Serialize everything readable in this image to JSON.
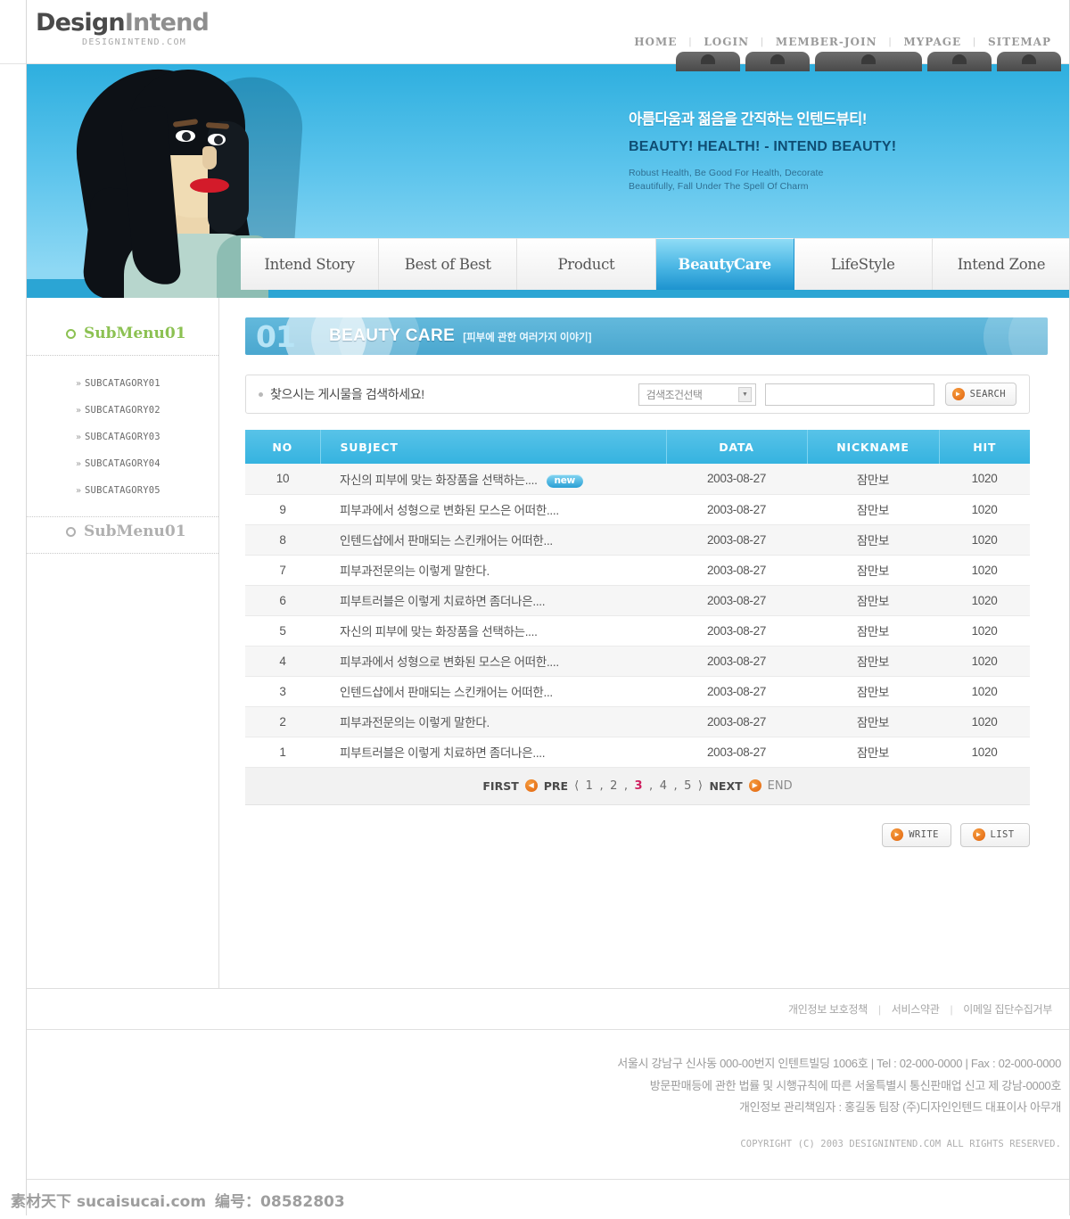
{
  "brand": {
    "logo_part1": "Design",
    "logo_part2": "Intend",
    "logo_domain": "DESIGNINTEND.COM"
  },
  "topnav": {
    "items": [
      "HOME",
      "LOGIN",
      "MEMBER-JOIN",
      "MYPAGE",
      "SITEMAP"
    ],
    "separator": "|"
  },
  "hero": {
    "korean_headline": "아름다움과 젊음을 간직하는 인텐드뷰티!",
    "english_headline": "BEAUTY! HEALTH! - INTEND BEAUTY!",
    "sub_line1": "Robust Health, Be Good For  Health, Decorate",
    "sub_line2": "Beautifully, Fall Under The Spell Of  Charm"
  },
  "mainnav": {
    "tabs": [
      {
        "label": "Intend Story",
        "active": false
      },
      {
        "label": "Best of Best",
        "active": false
      },
      {
        "label": "Product",
        "active": false
      },
      {
        "label": "BeautyCare",
        "active": true
      },
      {
        "label": "LifeStyle",
        "active": false
      },
      {
        "label": "Intend Zone",
        "active": false
      }
    ]
  },
  "sidebar": {
    "menu1_title": "SubMenu01",
    "menu2_title": "SubMenu01",
    "chevron": "»",
    "subcategories": [
      "SUBCATAGORY01",
      "SUBCATAGORY02",
      "SUBCATAGORY03",
      "SUBCATAGORY04",
      "SUBCATAGORY05"
    ]
  },
  "banner": {
    "number": "01",
    "title": "BEAUTY CARE",
    "subtitle": "[피부에 관한 여러가지 이야기]"
  },
  "search": {
    "label": "찾으시는 게시물을 검색하세요!",
    "select_value": "검색조건선택",
    "input_value": "",
    "input_placeholder": "",
    "button_label": "SEARCH",
    "caret": "▼",
    "arrow": "▶"
  },
  "table": {
    "headers": [
      "NO",
      "SUBJECT",
      "DATA",
      "NICKNAME",
      "HIT"
    ],
    "new_badge": "new",
    "rows": [
      {
        "no": "10",
        "subject": "자신의 피부에 맞는 화장품을 선택하는....",
        "date": "2003-08-27",
        "nickname": "잠만보",
        "hit": "1020",
        "is_new": true
      },
      {
        "no": "9",
        "subject": "피부과에서 성형으로 변화된 모스은 어떠한....",
        "date": "2003-08-27",
        "nickname": "잠만보",
        "hit": "1020",
        "is_new": false
      },
      {
        "no": "8",
        "subject": "인텐드샵에서 판매되는 스킨캐어는 어떠한...",
        "date": "2003-08-27",
        "nickname": "잠만보",
        "hit": "1020",
        "is_new": false
      },
      {
        "no": "7",
        "subject": "피부과전문의는 이렇게 말한다.",
        "date": "2003-08-27",
        "nickname": "잠만보",
        "hit": "1020",
        "is_new": false
      },
      {
        "no": "6",
        "subject": "피부트러블은 이렇게 치료하면 좀더나은....",
        "date": "2003-08-27",
        "nickname": "잠만보",
        "hit": "1020",
        "is_new": false
      },
      {
        "no": "5",
        "subject": "자신의 피부에 맞는 화장품을 선택하는....",
        "date": "2003-08-27",
        "nickname": "잠만보",
        "hit": "1020",
        "is_new": false
      },
      {
        "no": "4",
        "subject": "피부과에서 성형으로 변화된 모스은 어떠한....",
        "date": "2003-08-27",
        "nickname": "잠만보",
        "hit": "1020",
        "is_new": false
      },
      {
        "no": "3",
        "subject": "인텐드샵에서 판매되는 스킨캐어는 어떠한...",
        "date": "2003-08-27",
        "nickname": "잠만보",
        "hit": "1020",
        "is_new": false
      },
      {
        "no": "2",
        "subject": "피부과전문의는 이렇게 말한다.",
        "date": "2003-08-27",
        "nickname": "잠만보",
        "hit": "1020",
        "is_new": false
      },
      {
        "no": "1",
        "subject": "피부트러블은 이렇게 치료하면 좀더나은....",
        "date": "2003-08-27",
        "nickname": "잠만보",
        "hit": "1020",
        "is_new": false
      }
    ]
  },
  "pager": {
    "first": "FIRST",
    "pre": "PRE",
    "open": "⟨",
    "close": "⟩",
    "pages": [
      "1",
      "2",
      "3",
      "4",
      "5"
    ],
    "current_page": "3",
    "next": "NEXT",
    "end": "END",
    "left_arrow": "◀",
    "right_arrow": "▶"
  },
  "actions": {
    "write_label": "WRITE",
    "list_label": "LIST",
    "arrow": "▶"
  },
  "footer": {
    "links": [
      "개인정보 보호정책",
      "서비스약관",
      "이메일 집단수집거부"
    ],
    "separator": "|",
    "address_line1": "서울시  강남구 신사동 000-00번지  인텐트빌딩 1006호   | Tel : 02-000-0000 | Fax : 02-000-0000",
    "address_line2": "방문판매등에 관한 법률 및 시행규칙에 따른 서울특별시 통신판매업 신고 제 강남-0000호",
    "address_line3": "개인정보 관리책임자 : 홍길동 팀장 (주)디자인인텐드 대표이사 아무개",
    "copyright": "COPYRIGHT (C) 2003 DESIGNINTEND.COM ALL RIGHTS RESERVED."
  },
  "watermark": {
    "site": "素材天下 sucaisucai.com",
    "code": "编号：08582803"
  },
  "colors": {
    "accent_blue": "#35b3e0",
    "hero_blue": "#5cc4ec",
    "active_tab": "#1d93cf",
    "green": "#8cc152",
    "orange": "#e2650f",
    "pager_current": "#cf2060"
  }
}
